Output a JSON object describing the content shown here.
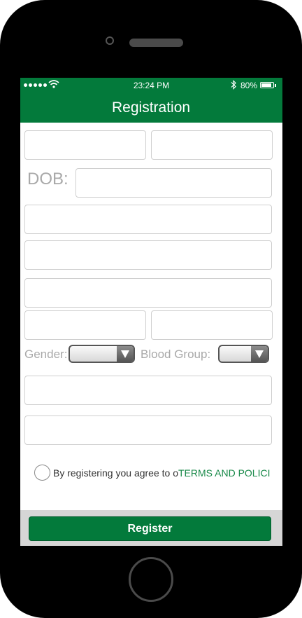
{
  "status_bar": {
    "time": "23:24 PM",
    "battery_percent": "80%",
    "signal_icon": "signal-dots-icon",
    "wifi_icon": "wifi-icon",
    "bluetooth_icon": "bluetooth-icon",
    "battery_icon": "battery-icon"
  },
  "nav": {
    "title": "Registration"
  },
  "form": {
    "dob_label": "DOB:",
    "gender_label": "Gender:",
    "blood_group_label": "Blood Group:",
    "agree_text": "By registering you agree to o",
    "terms_link": "TERMS AND POLICIE"
  },
  "register_button": {
    "label": "Register"
  },
  "colors": {
    "brand_green": "#037a3b",
    "link_green": "#1a8a4a",
    "label_gray": "#a9a9a9"
  }
}
